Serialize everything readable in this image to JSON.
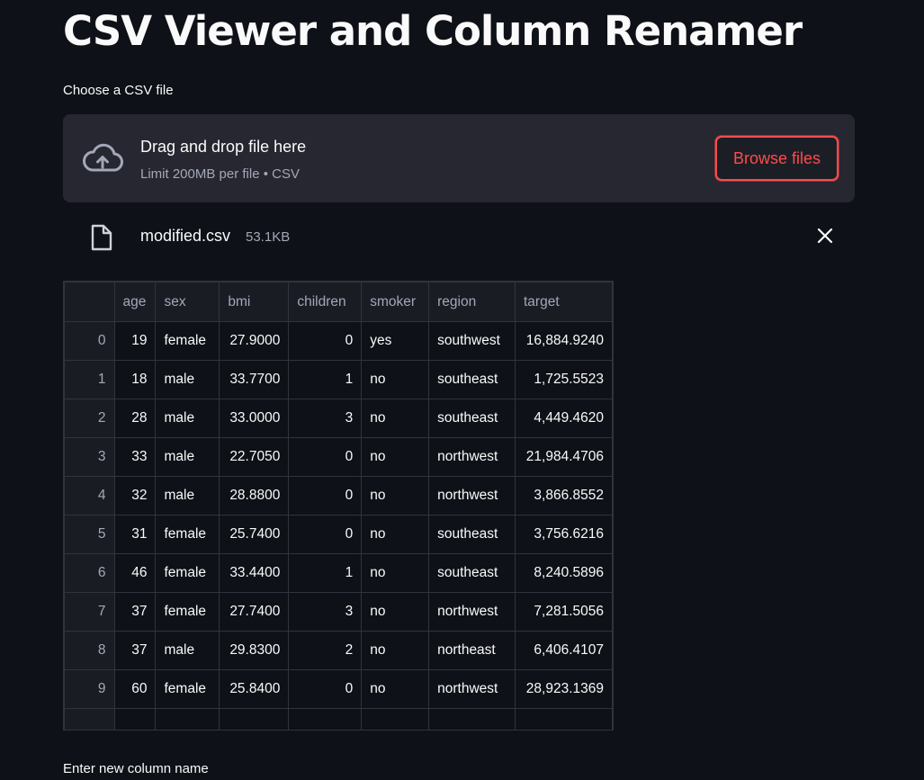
{
  "page": {
    "title": "CSV Viewer and Column Renamer"
  },
  "uploader": {
    "label": "Choose a CSV file",
    "drop_text": "Drag and drop file here",
    "limit_text": "Limit 200MB per file • CSV",
    "browse_label": "Browse files",
    "icon": "cloud-upload-icon",
    "accent_color": "#ff4b4b"
  },
  "uploaded_file": {
    "name": "modified.csv",
    "size": "53.1KB",
    "icon": "file-icon",
    "remove_icon": "close-icon"
  },
  "table": {
    "columns": [
      "",
      "age",
      "sex",
      "bmi",
      "children",
      "smoker",
      "region",
      "target"
    ],
    "rows": [
      {
        "index": "0",
        "age": "19",
        "sex": "female",
        "bmi": "27.9000",
        "children": "0",
        "smoker": "yes",
        "region": "southwest",
        "target": "16,884.9240"
      },
      {
        "index": "1",
        "age": "18",
        "sex": "male",
        "bmi": "33.7700",
        "children": "1",
        "smoker": "no",
        "region": "southeast",
        "target": "1,725.5523"
      },
      {
        "index": "2",
        "age": "28",
        "sex": "male",
        "bmi": "33.0000",
        "children": "3",
        "smoker": "no",
        "region": "southeast",
        "target": "4,449.4620"
      },
      {
        "index": "3",
        "age": "33",
        "sex": "male",
        "bmi": "22.7050",
        "children": "0",
        "smoker": "no",
        "region": "northwest",
        "target": "21,984.4706"
      },
      {
        "index": "4",
        "age": "32",
        "sex": "male",
        "bmi": "28.8800",
        "children": "0",
        "smoker": "no",
        "region": "northwest",
        "target": "3,866.8552"
      },
      {
        "index": "5",
        "age": "31",
        "sex": "female",
        "bmi": "25.7400",
        "children": "0",
        "smoker": "no",
        "region": "southeast",
        "target": "3,756.6216"
      },
      {
        "index": "6",
        "age": "46",
        "sex": "female",
        "bmi": "33.4400",
        "children": "1",
        "smoker": "no",
        "region": "southeast",
        "target": "8,240.5896"
      },
      {
        "index": "7",
        "age": "37",
        "sex": "female",
        "bmi": "27.7400",
        "children": "3",
        "smoker": "no",
        "region": "northwest",
        "target": "7,281.5056"
      },
      {
        "index": "8",
        "age": "37",
        "sex": "male",
        "bmi": "29.8300",
        "children": "2",
        "smoker": "no",
        "region": "northeast",
        "target": "6,406.4107"
      },
      {
        "index": "9",
        "age": "60",
        "sex": "female",
        "bmi": "25.8400",
        "children": "0",
        "smoker": "no",
        "region": "northwest",
        "target": "28,923.1369"
      },
      {
        "index": "",
        "age": "",
        "sex": "",
        "bmi": "",
        "children": "",
        "smoker": "",
        "region": "",
        "target": ""
      }
    ]
  },
  "rename": {
    "label": "Enter new column name"
  }
}
